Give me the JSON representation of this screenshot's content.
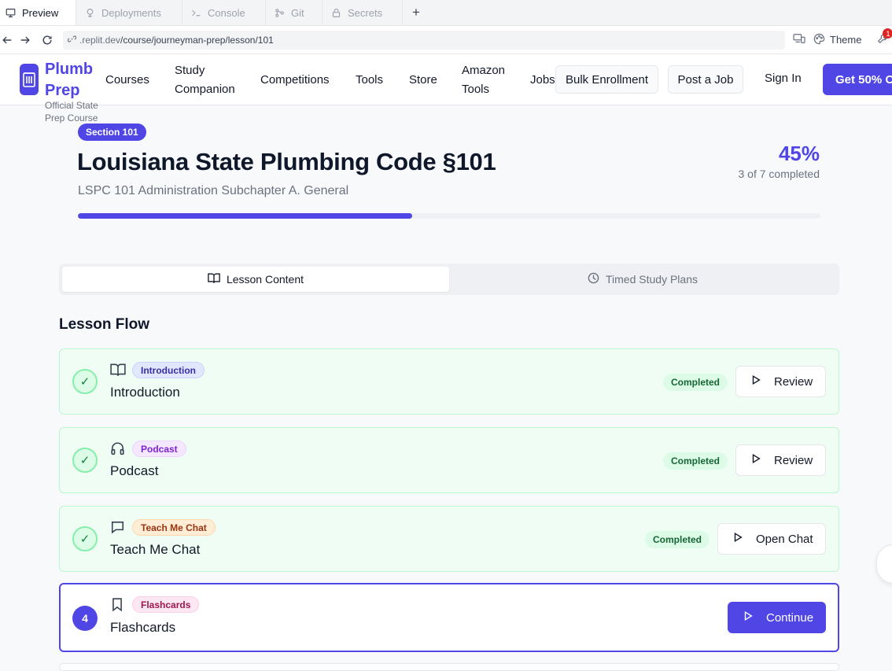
{
  "replit": {
    "tabs": [
      {
        "label": "Preview",
        "icon": "monitor-icon"
      },
      {
        "label": "Deployments",
        "icon": "deployments-icon"
      },
      {
        "label": "Console",
        "icon": "terminal-icon"
      },
      {
        "label": "Git",
        "icon": "git-icon"
      },
      {
        "label": "Secrets",
        "icon": "lock-icon"
      }
    ],
    "add_tab": "+",
    "url_prefix": ".replit.dev",
    "url_path": "/course/journeyman-prep/lesson/101",
    "theme_label": "Theme",
    "notification_count": "1"
  },
  "site": {
    "brand": "Plumb Prep",
    "brand_sub": "Official State Prep Course",
    "nav": [
      "Courses",
      "Study Companion",
      "Competitions",
      "Tools",
      "Store",
      "Amazon Tools",
      "Jobs"
    ],
    "bulk_enrollment": "Bulk Enrollment",
    "post_job": "Post a Job",
    "sign_in": "Sign In",
    "cta": "Get 50% O"
  },
  "lesson": {
    "section_badge": "Section 101",
    "title": "Louisiana State Plumbing Code §101",
    "subtitle": "LSPC 101 Administration Subchapter A. General",
    "progress_percent_label": "45%",
    "progress_fraction": 0.45,
    "completed_label": "3 of 7 completed"
  },
  "tabs": {
    "lesson_content": "Lesson Content",
    "timed_study_plans": "Timed Study Plans"
  },
  "flow": {
    "title": "Lesson Flow",
    "items": [
      {
        "step": "✓",
        "type": "Introduction",
        "name": "Introduction",
        "status": "Completed",
        "action": "Review",
        "icon": "book-icon",
        "pill_bg": "#e0e7ff",
        "pill_fg": "#3730a3",
        "pill_border": "#c7d2fe"
      },
      {
        "step": "✓",
        "type": "Podcast",
        "name": "Podcast",
        "status": "Completed",
        "action": "Review",
        "icon": "headphones-icon",
        "pill_bg": "#f3e8ff",
        "pill_fg": "#7e22ce",
        "pill_border": "#e9d5ff"
      },
      {
        "step": "✓",
        "type": "Teach Me Chat",
        "name": "Teach Me Chat",
        "status": "Completed",
        "action": "Open Chat",
        "icon": "chat-icon",
        "pill_bg": "#ffedd5",
        "pill_fg": "#9a3412",
        "pill_border": "#fed7aa"
      },
      {
        "step": "4",
        "type": "Flashcards",
        "name": "Flashcards",
        "status": "",
        "action": "Continue",
        "icon": "bookmark-icon",
        "pill_bg": "#fce7f3",
        "pill_fg": "#9d174d",
        "pill_border": "#fbcfe8"
      }
    ]
  }
}
